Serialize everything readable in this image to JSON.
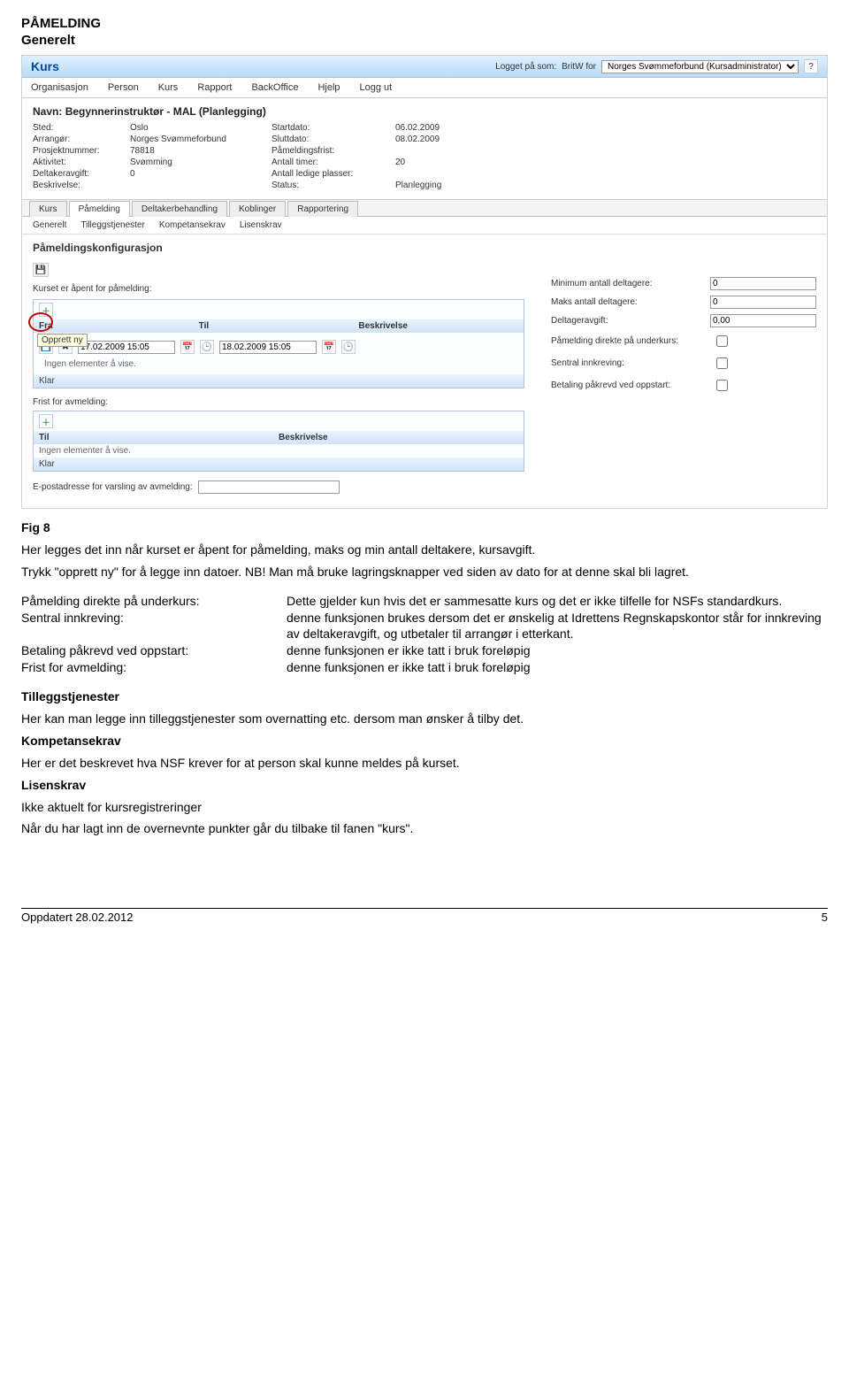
{
  "doc": {
    "heading": "PÅMELDING",
    "subheading": "Generelt",
    "fig_label": "Fig 8",
    "intro_p1": "Her legges det inn når kurset er åpent for påmelding, maks og min antall deltakere, kursavgift.",
    "intro_p2": "Trykk \"opprett ny\" for å legge inn datoer. NB! Man må bruke lagringsknapper ved siden av dato for at denne skal bli lagret.",
    "defs": [
      {
        "term": "Påmelding direkte på underkurs:",
        "desc": "Dette gjelder kun hvis det er sammesatte kurs og det er ikke tilfelle for NSFs standardkurs."
      },
      {
        "term": "Sentral innkreving:",
        "desc": "denne funksjonen brukes dersom det er ønskelig at Idrettens Regnskapskontor står for innkreving av deltakeravgift, og utbetaler til arrangør i etterkant."
      },
      {
        "term": "Betaling påkrevd ved oppstart:",
        "desc": "denne funksjonen er ikke tatt i bruk foreløpig"
      },
      {
        "term": "Frist for avmelding:",
        "desc": "denne funksjonen er ikke tatt i bruk foreløpig"
      }
    ],
    "tillegg_head": "Tilleggstjenester",
    "tillegg_body": "Her kan man legge inn tilleggstjenester som overnatting etc. dersom man ønsker å tilby det.",
    "komp_head": "Kompetansekrav",
    "komp_body": "Her er det beskrevet hva NSF krever for at person skal kunne meldes på kurset.",
    "lisens_head": "Lisenskrav",
    "lisens_body": "Ikke aktuelt for kursregistreringer",
    "closing": "Når du har lagt inn de overnevnte punkter går du tilbake til fanen \"kurs\".",
    "footer_left": "Oppdatert 28.02.2012",
    "footer_right": "5"
  },
  "app": {
    "title": "Kurs",
    "logged_in_label": "Logget på som:",
    "logged_in_user": "BritW for",
    "org_select": "Norges Svømmeforbund (Kursadministrator)",
    "menu": [
      "Organisasjon",
      "Person",
      "Kurs",
      "Rapport",
      "BackOffice",
      "Hjelp",
      "Logg ut"
    ],
    "details": {
      "name_label": "Navn:",
      "name_value": "Begynnerinstruktør - MAL (Planlegging)",
      "rows": [
        [
          "Sted:",
          "Oslo",
          "Startdato:",
          "06.02.2009"
        ],
        [
          "Arrangør:",
          "Norges Svømmeforbund",
          "Sluttdato:",
          "08.02.2009"
        ],
        [
          "Prosjektnummer:",
          "78818",
          "Påmeldingsfrist:",
          ""
        ],
        [
          "Aktivitet:",
          "Svømming",
          "Antall timer:",
          "20"
        ],
        [
          "Deltakeravgift:",
          "0",
          "Antall ledige plasser:",
          ""
        ],
        [
          "Beskrivelse:",
          "",
          "Status:",
          "Planlegging"
        ]
      ]
    },
    "inner_tabs": [
      "Kurs",
      "Påmelding",
      "Deltakerbehandling",
      "Koblinger",
      "Rapportering"
    ],
    "inner_tab_active": 1,
    "sub_tabs": [
      "Generelt",
      "Tilleggstjenester",
      "Kompetansekrav",
      "Lisenskrav"
    ],
    "config": {
      "title": "Påmeldingskonfigurasjon",
      "open_label": "Kurset er åpent for påmelding:",
      "panel1": {
        "cols": [
          "Fra",
          "Til",
          "Beskrivelse"
        ],
        "tooltip": "Opprett ny",
        "fra_value": "17.02.2009 15:05",
        "til_value": "18.02.2009 15:05",
        "empty": "Ingen elementer å vise.",
        "footer": "Klar"
      },
      "frist_label": "Frist for avmelding:",
      "panel2": {
        "cols": [
          "Til",
          "Beskrivelse"
        ],
        "empty": "Ingen elementer å vise.",
        "footer": "Klar"
      },
      "epost_label": "E-postadresse for varsling av avmelding:",
      "epost_value": "",
      "right": {
        "min_label": "Minimum antall deltagere:",
        "min_value": "0",
        "max_label": "Maks antall deltagere:",
        "max_value": "0",
        "avgift_label": "Deltageravgift:",
        "avgift_value": "0,00",
        "direkte_label": "Påmelding direkte på underkurs:",
        "sentral_label": "Sentral innkreving:",
        "betaling_label": "Betaling påkrevd ved oppstart:"
      }
    }
  }
}
